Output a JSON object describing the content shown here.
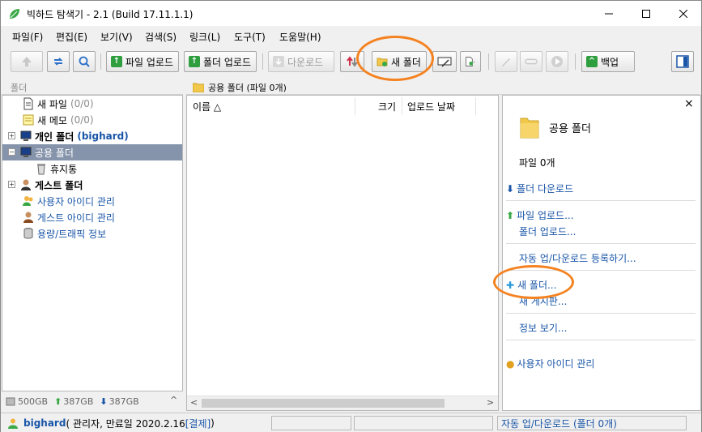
{
  "title": "빅하드 탐색기 - 2.1 (Build 17.11.1.1)",
  "window_controls": {
    "minimize": "minimize-icon",
    "maximize": "maximize-icon",
    "close": "close-icon"
  },
  "menu": [
    "파일(F)",
    "편집(E)",
    "보기(V)",
    "검색(S)",
    "링크(L)",
    "도구(T)",
    "도움말(H)"
  ],
  "toolbar": {
    "file_upload": "파일 업로드",
    "folder_upload": "폴더 업로드",
    "download": "다운로드",
    "new_folder": "새 폴더",
    "backup": "백업"
  },
  "left_pane": {
    "header": "폴더",
    "items": {
      "new_file": "새 파일",
      "new_file_count": "(0/0)",
      "new_memo": "새 메모",
      "new_memo_count": "(0/0)",
      "personal_folder": "개인 폴더",
      "personal_owner": "(bighard)",
      "shared_folder": "공용 폴더",
      "trash": "휴지통",
      "guest_folder": "게스트 폴더",
      "user_id_manage": "사용자 아이디 관리",
      "guest_id_manage": "게스트 아이디 관리",
      "capacity_traffic": "용량/트래픽 정보"
    },
    "status": {
      "capacity": "500GB",
      "upload": "387GB",
      "download": "387GB"
    }
  },
  "main": {
    "path": "공용 폴더 (파일 0개)",
    "columns": {
      "name": "이름 △",
      "size": "크기",
      "upload_date": "업로드 날짜"
    }
  },
  "right_pane": {
    "folder_title": "공용 폴더",
    "file_count": "파일 0개",
    "folder_download": "폴더 다운로드",
    "file_upload": "파일 업로드...",
    "folder_upload": "폴더 업로드...",
    "auto_register": "자동 업/다운로드 등록하기...",
    "new_folder": "새 폴더...",
    "new_board": "새 게시판...",
    "view_info": "정보 보기...",
    "user_id_manage": "사용자 아이디 관리"
  },
  "statusbar": {
    "user": "bighard",
    "info": "( 관리자, 만료일 2020.2.16 ",
    "payment": "[결제]",
    "info_close": " )",
    "auto_updown": "자동 업/다운로드 (폴더 0개)"
  },
  "colors": {
    "highlight": "#f58220",
    "selection": "#8694ab",
    "link": "#1a56a8",
    "accent_green": "#2e9e3e"
  }
}
